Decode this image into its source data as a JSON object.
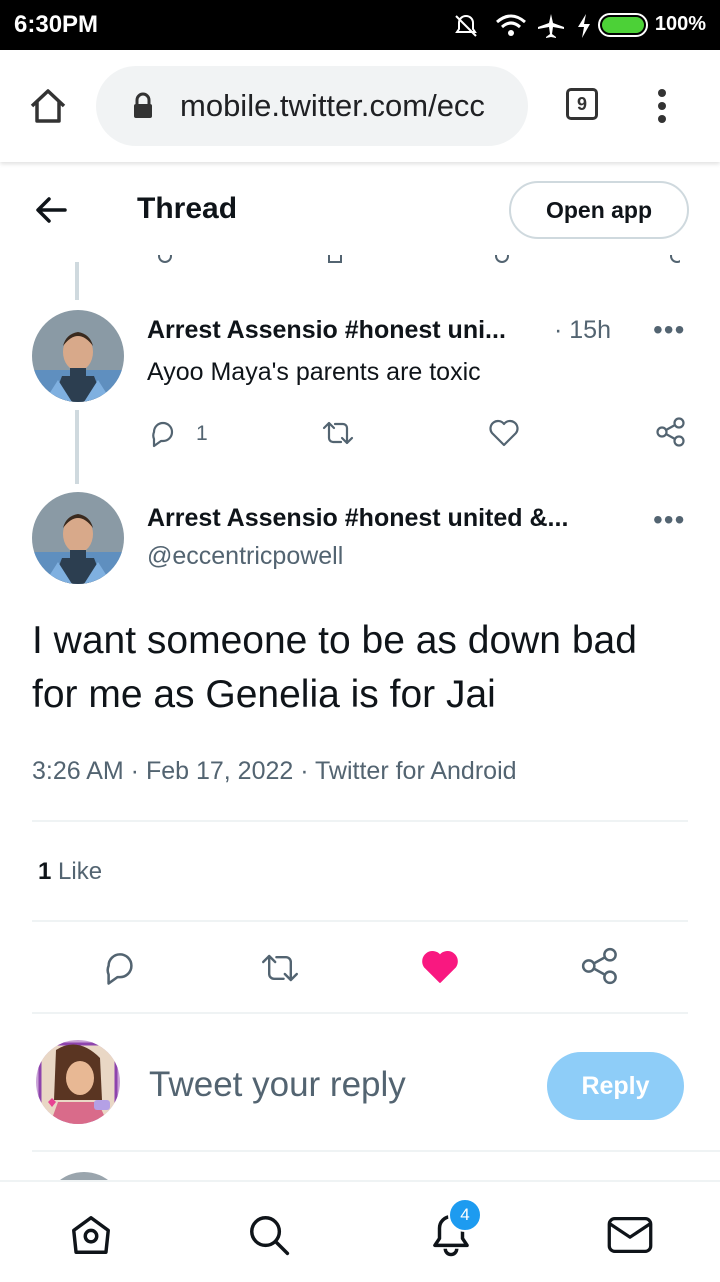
{
  "status_bar": {
    "time": "6:30PM",
    "battery_pct": "100%"
  },
  "browser": {
    "url": "mobile.twitter.com/ecc",
    "tab_count": "9"
  },
  "header": {
    "title": "Thread",
    "open_app_label": "Open app"
  },
  "prev_tweet": {
    "author": "Arrest Assensio #honest uni...",
    "time": "· 15h",
    "text": "Ayoo Maya's parents are toxic",
    "reply_count": "1",
    "more": "•••"
  },
  "main_tweet": {
    "author": "Arrest Assensio #honest united &...",
    "handle": "@eccentricpowell",
    "text": "I want someone to be as down bad for me as Genelia is for Jai",
    "meta": "3:26 AM · Feb 17, 2022 · Twitter for Android",
    "likes_count": "1",
    "likes_label": "Like",
    "more": "•••",
    "liked": true
  },
  "reply_box": {
    "placeholder": "Tweet your reply",
    "button_label": "Reply"
  },
  "bottom_nav": {
    "notifications_badge": "4"
  },
  "colors": {
    "accent": "#1d9bf0",
    "like": "#f91880",
    "reply_disabled": "#8ecdf8"
  }
}
